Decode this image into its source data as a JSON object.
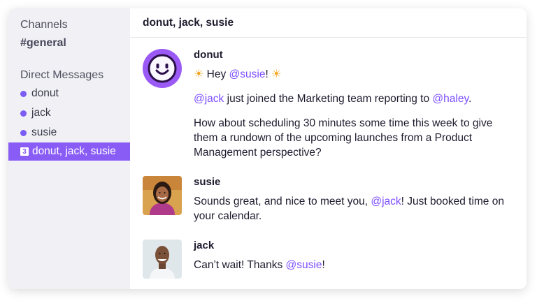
{
  "sidebar": {
    "channels_heading": "Channels",
    "channel": "#general",
    "dm_heading": "Direct Messages",
    "items": [
      {
        "label": "donut"
      },
      {
        "label": "jack"
      },
      {
        "label": "susie"
      },
      {
        "label": "donut, jack, susie",
        "badge": "3",
        "active": true
      }
    ]
  },
  "header": {
    "title": "donut, jack, susie"
  },
  "colors": {
    "accent": "#8a5cf6",
    "mention": "#7c4dff",
    "avatar_donut": "#9b59f5"
  },
  "messages": [
    {
      "author": "donut",
      "avatar_icon": "smiley-icon",
      "greeting": {
        "sun_left": "☀",
        "pre": "Hey ",
        "mention": "@susie",
        "post": "! ",
        "sun_right": "☀"
      },
      "line2": {
        "mention1": "@jack",
        "text": " just joined the Marketing team reporting to ",
        "mention2": "@haley",
        "end": "."
      },
      "line3": [
        " How about scheduling 30 minutes some time this week to give",
        "them a rundown of the upcoming launches from a Product",
        "Management perspective?"
      ]
    },
    {
      "author": "susie",
      "avatar_icon": "user-photo-icon",
      "text_pre": "Sounds great, and nice to meet you, ",
      "mention": "@jack",
      "text_post": "! Just booked time on",
      "text_line2": "your calendar."
    },
    {
      "author": "jack",
      "avatar_icon": "user-photo-icon",
      "text_pre": "Can’t wait! Thanks ",
      "mention": "@susie",
      "text_post": "!"
    }
  ]
}
